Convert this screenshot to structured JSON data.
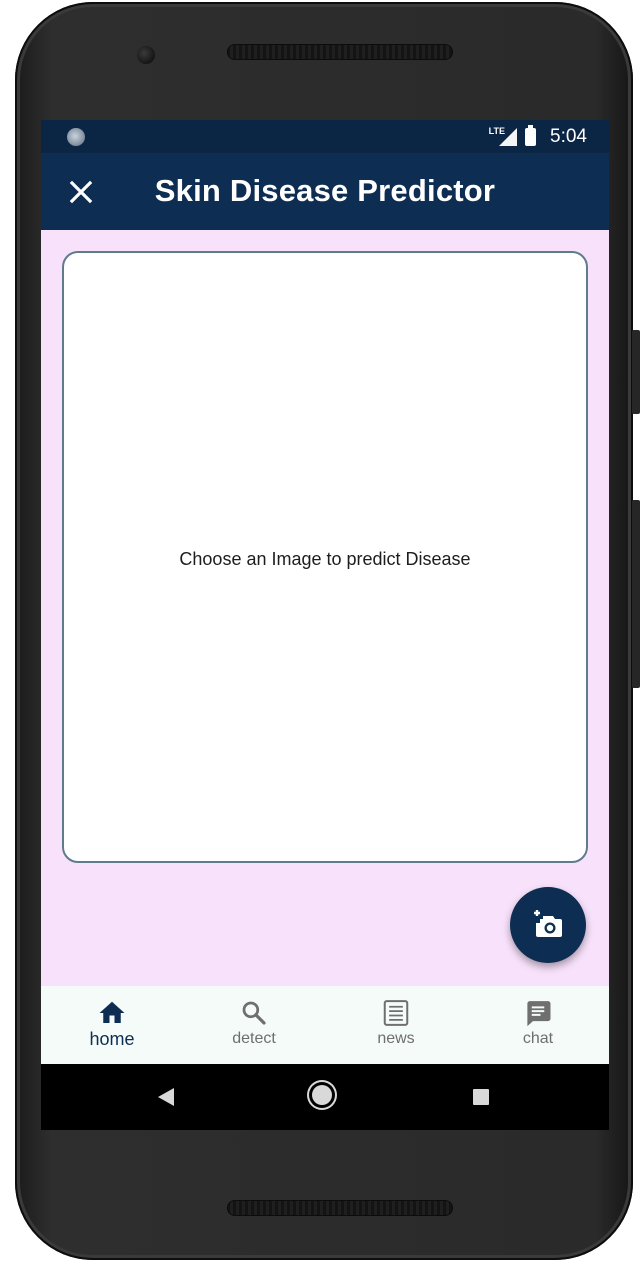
{
  "status_bar": {
    "time": "5:04",
    "network": "LTE"
  },
  "app_bar": {
    "title": "Skin Disease Predictor"
  },
  "image_card": {
    "prompt": "Choose an Image to predict Disease"
  },
  "fab": {
    "icon": "add-a-photo-icon"
  },
  "bottom_nav": {
    "items": [
      {
        "label": "home",
        "icon": "home-icon",
        "active": true
      },
      {
        "label": "detect",
        "icon": "search-icon",
        "active": false
      },
      {
        "label": "news",
        "icon": "newspaper-icon",
        "active": false
      },
      {
        "label": "chat",
        "icon": "chat-icon",
        "active": false
      }
    ]
  },
  "colors": {
    "primary": "#0d2e52",
    "background": "#f8e1fb",
    "nav_background": "#f4fbf8",
    "inactive": "#6f6f6f"
  }
}
